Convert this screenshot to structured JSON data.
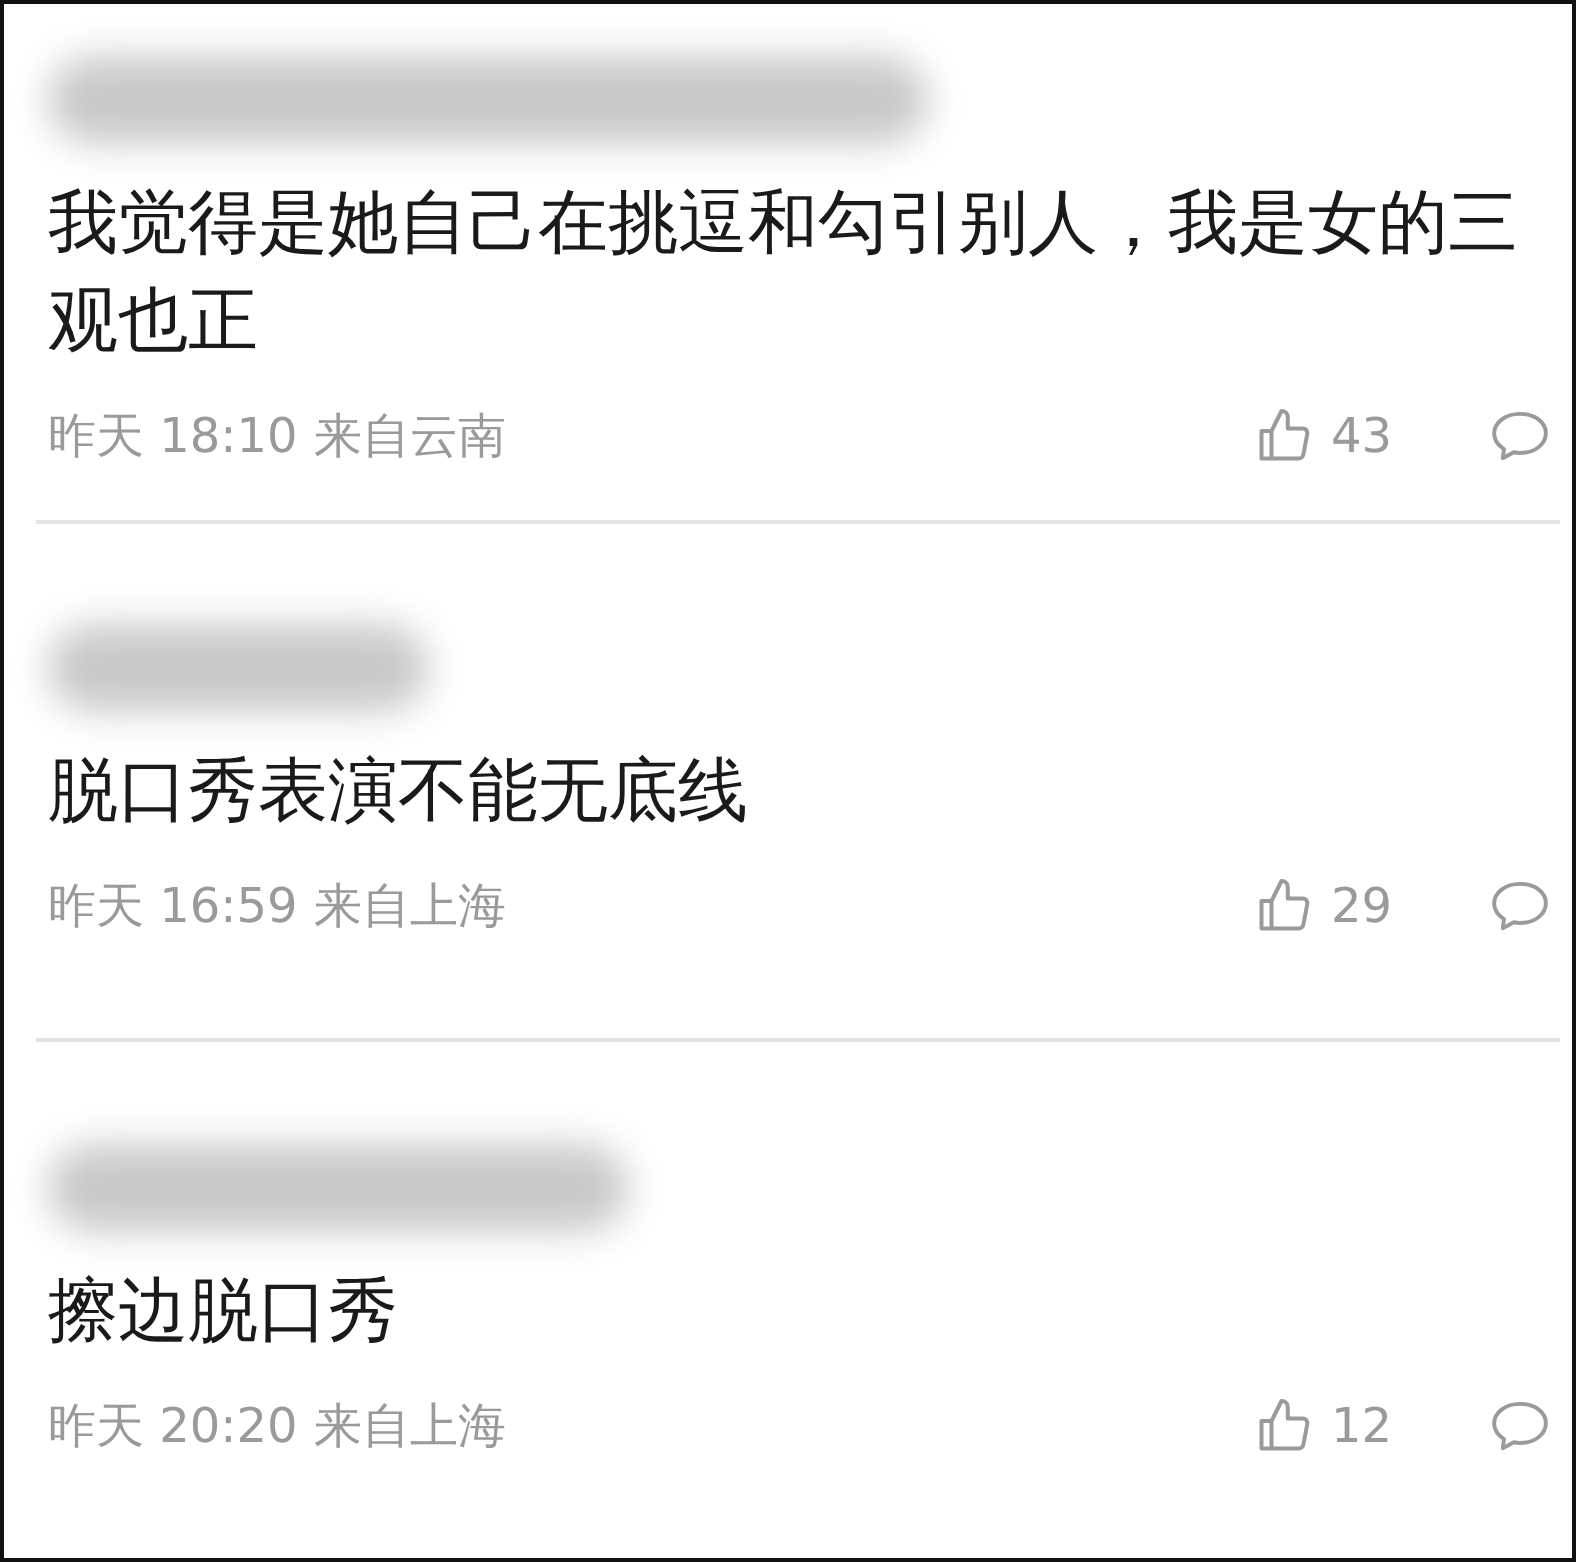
{
  "comments": [
    {
      "text": "我觉得是她自己在挑逗和勾引别人，我是女的三观也正",
      "time": "昨天 18:10",
      "location": "来自云南",
      "likes": "43"
    },
    {
      "text": "脱口秀表演不能无底线",
      "time": "昨天 16:59",
      "location": "来自上海",
      "likes": "29"
    },
    {
      "text": "擦边脱口秀",
      "time": "昨天 20:20",
      "location": "来自上海",
      "likes": "12"
    }
  ]
}
